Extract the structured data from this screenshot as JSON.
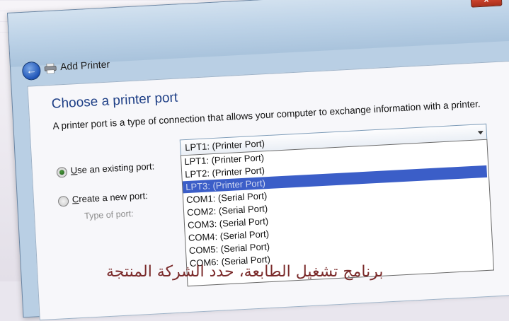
{
  "window": {
    "title": "Add Printer",
    "close_glyph": "x",
    "back_glyph": "←"
  },
  "content": {
    "heading": "Choose a printer port",
    "description": "A printer port is a type of connection that allows your computer to exchange information with a printer."
  },
  "port_options": {
    "existing": {
      "accesskey": "U",
      "label_rest": "se an existing port:",
      "selected": true
    },
    "create": {
      "accesskey": "C",
      "label_rest": "reate a new port:",
      "selected": false
    },
    "type_of_port_label": "Type of port:"
  },
  "combo": {
    "value": "LPT1: (Printer Port)"
  },
  "dropdown": {
    "items": [
      "LPT1: (Printer Port)",
      "LPT2: (Printer Port)",
      "LPT3: (Printer Port)",
      "COM1: (Serial Port)",
      "COM2: (Serial Port)",
      "COM3: (Serial Port)",
      "COM4: (Serial Port)",
      "COM5: (Serial Port)",
      "COM6: (Serial Port)"
    ],
    "selected_index": 2
  },
  "page_text": {
    "arabic_line": "برنامج تشغيل الطابعة، حدد الشركة المنتجة"
  },
  "colors": {
    "heading": "#1e3f86",
    "selection": "#3b5ec8",
    "radio_checked": "#1e5a1a"
  },
  "icons": [
    "close-icon",
    "back-arrow-icon",
    "printer-icon",
    "dropdown-arrow-icon"
  ]
}
